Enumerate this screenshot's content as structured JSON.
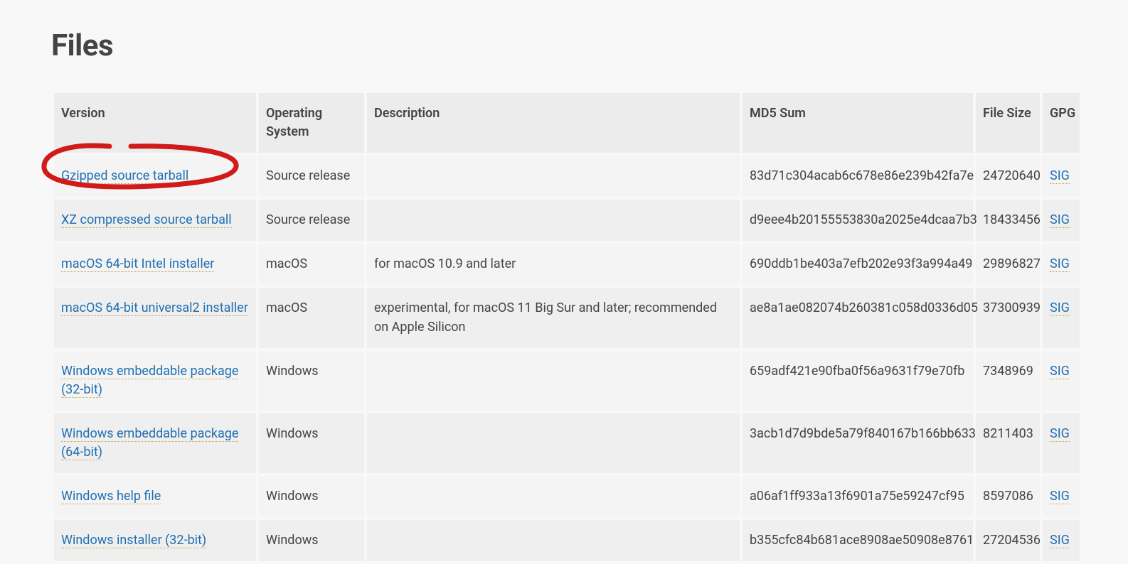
{
  "heading": "Files",
  "columns": [
    "Version",
    "Operating System",
    "Description",
    "MD5 Sum",
    "File Size",
    "GPG"
  ],
  "sig_label": "SIG",
  "rows": [
    {
      "version": "Gzipped source tarball",
      "os": "Source release",
      "description": "",
      "md5": "83d71c304acab6c678e86e239b42fa7e",
      "size": "24720640"
    },
    {
      "version": "XZ compressed source tarball",
      "os": "Source release",
      "description": "",
      "md5": "d9eee4b20155553830a2025e4dcaa7b3",
      "size": "18433456"
    },
    {
      "version": "macOS 64-bit Intel installer",
      "os": "macOS",
      "description": "for macOS 10.9 and later",
      "md5": "690ddb1be403a7efb202e93f3a994a49",
      "size": "29896827"
    },
    {
      "version": "macOS 64-bit universal2 installer",
      "os": "macOS",
      "description": "experimental, for macOS 11 Big Sur and later; recommended on Apple Silicon",
      "md5": "ae8a1ae082074b260381c058d0336d05",
      "size": "37300939"
    },
    {
      "version": "Windows embeddable package (32-bit)",
      "os": "Windows",
      "description": "",
      "md5": "659adf421e90fba0f56a9631f79e70fb",
      "size": "7348969"
    },
    {
      "version": "Windows embeddable package (64-bit)",
      "os": "Windows",
      "description": "",
      "md5": "3acb1d7d9bde5a79f840167b166bb633",
      "size": "8211403"
    },
    {
      "version": "Windows help file",
      "os": "Windows",
      "description": "",
      "md5": "a06af1ff933a13f6901a75e59247cf95",
      "size": "8597086"
    },
    {
      "version": "Windows installer (32-bit)",
      "os": "Windows",
      "description": "",
      "md5": "b355cfc84b681ace8908ae50908e8761",
      "size": "27204536"
    }
  ]
}
